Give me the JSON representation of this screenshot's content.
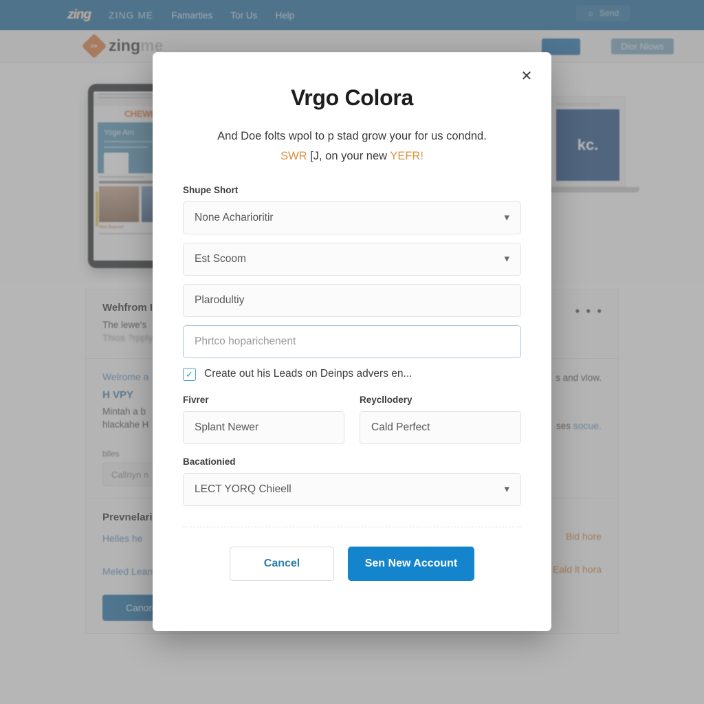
{
  "topbar": {
    "brand_mark": "zing",
    "brand_word": "ZING ME",
    "links": [
      "Famarties",
      "Tor Us",
      "Help"
    ],
    "user_icon": "person-icon",
    "user_label": "Send"
  },
  "subheader": {
    "logo_badge": "zm",
    "logo_text_main": "zing",
    "logo_text_dim": "me",
    "secondary_button": "Dior Nlows"
  },
  "hero": {
    "tablet": {
      "site_logo": "CHEWE",
      "hero_heading": "Yoge Am",
      "footer_link": "Moe Boatcorf"
    },
    "laptop": {
      "screen_text": "kc."
    }
  },
  "background_card": {
    "section1": {
      "title": "Wehfrom I",
      "line1": "The lewe's",
      "line2": "Thios ?rpply",
      "right_text": "s and vlow.",
      "dots_menu": "• • •"
    },
    "section2": {
      "link": "Welrome a",
      "subtitle": "H VPY",
      "line1": "Mintah a b",
      "line2": "hlackahe H",
      "right_text_plain": "ses ",
      "right_link": "socue."
    },
    "section3": {
      "field_label": "blles",
      "field_value": "Callnyn n"
    },
    "section4": {
      "title": "Prevnelari",
      "link1": "Helles he",
      "link2": "Meled Learn slep color'",
      "orange1": "Bid hore",
      "orange2": "Eald lt hora",
      "button": "Canore"
    }
  },
  "modal": {
    "close_icon": "close-icon",
    "title": "Vrgo Colora",
    "subtitle": "And Doe folts wpol to p stad grow your for us condnd.",
    "subtitle2_part1": "SWR",
    "subtitle2_part2": "[J, on your new",
    "subtitle2_part3": "YEFR!",
    "accent_color": "#d9913f",
    "primary_color": "#1484cd",
    "form": {
      "shape_label": "Shupe Short",
      "select1_value": "None Acharioritir",
      "select2_value": "Est Scoom",
      "text1_value": "Plarodultiy",
      "text2_placeholder": "Phrtco hoparichenent",
      "checkbox_checked": true,
      "checkbox_label": "Create out his Leads on Deinps advers en...",
      "col_left_label": "Fivrer",
      "col_left_value": "Splant Newer",
      "col_right_label": "Reycllodery",
      "col_right_value": "Cald Perfect",
      "bottom_label": "Bacationied",
      "bottom_select_value": "LECT YORQ Chieell",
      "chevron_icon": "chevron-down-icon"
    },
    "cancel_label": "Cancel",
    "submit_label": "Sen New Account"
  }
}
